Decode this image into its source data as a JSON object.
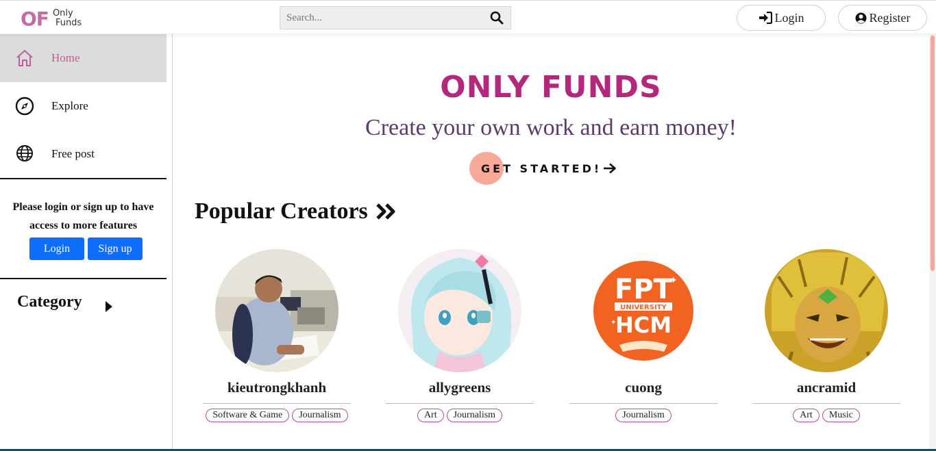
{
  "header": {
    "logo_mark": "OF",
    "logo_word1": "Only",
    "logo_word2": "Funds",
    "search_placeholder": "Search...",
    "login_label": "Login",
    "register_label": "Register"
  },
  "sidebar": {
    "items": [
      {
        "label": "Home",
        "icon": "home-icon",
        "active": true
      },
      {
        "label": "Explore",
        "icon": "compass-icon",
        "active": false
      },
      {
        "label": "Free post",
        "icon": "globe-icon",
        "active": false
      }
    ],
    "login_note": "Please login or sign up to have access to more features",
    "login_button": "Login",
    "signup_button": "Sign up",
    "category_label": "Category"
  },
  "hero": {
    "title": "ONLY FUNDS",
    "subtitle": "Create your own work and earn money!",
    "cta": "GET STARTED!"
  },
  "popular": {
    "title": "Popular Creators",
    "creators": [
      {
        "name": "kieutrongkhanh",
        "tags": [
          "Software & Game",
          "Journalism"
        ],
        "avatar": "office-photo"
      },
      {
        "name": "allygreens",
        "tags": [
          "Art",
          "Journalism"
        ],
        "avatar": "anime-girl"
      },
      {
        "name": "cuong",
        "tags": [
          "Journalism"
        ],
        "avatar": "fpt-logo"
      },
      {
        "name": "ancramid",
        "tags": [
          "Art",
          "Music"
        ],
        "avatar": "golden-character"
      }
    ]
  },
  "fpt_logo_text": {
    "line1": "FPT",
    "line2": "UNIVERSITY",
    "line3": "HCM"
  },
  "colors": {
    "brand_pink": "#c868a4",
    "hero_title": "#b4277d",
    "hero_subtitle": "#5b3a6c",
    "cta_dot": "#f8a99a",
    "primary_blue": "#0d6efd",
    "scrollbar": "#f4a59d"
  }
}
